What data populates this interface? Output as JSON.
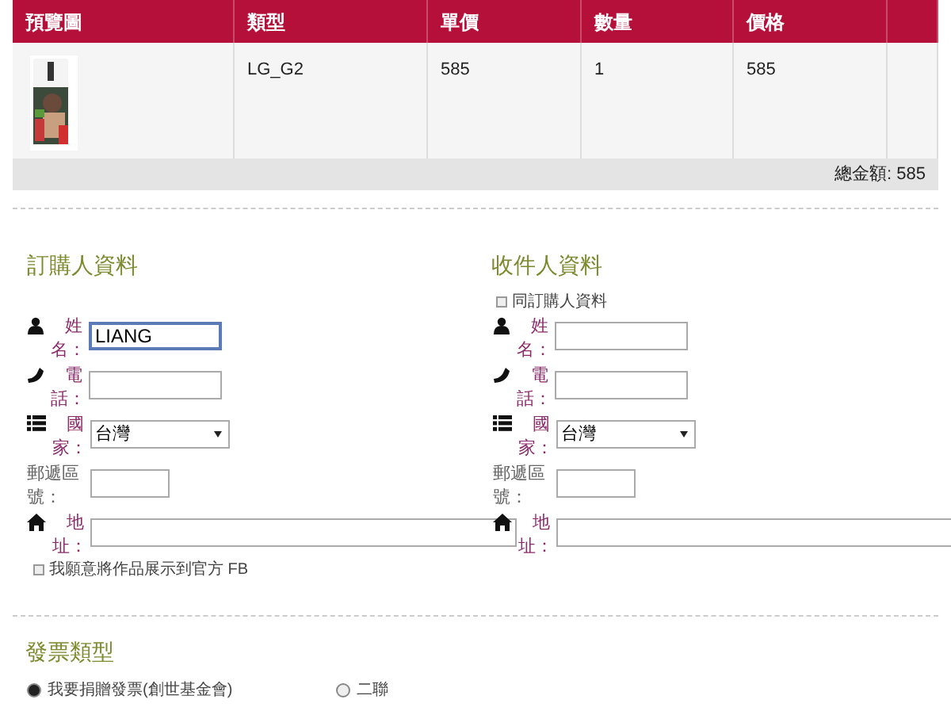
{
  "cart": {
    "columns": [
      "預覽圖",
      "類型",
      "單價",
      "數量",
      "價格",
      ""
    ],
    "rows": [
      {
        "type": "LG_G2",
        "unit_price": "585",
        "quantity": "1",
        "price": "585"
      }
    ],
    "total": "總金額: 585"
  },
  "buyer": {
    "title": "訂購人資料",
    "fields": [
      {
        "kind": "text",
        "label": "姓名：",
        "value": "LIANG",
        "focused": true
      },
      {
        "kind": "text",
        "label": "電話：",
        "focused": false
      },
      {
        "kind": "select",
        "label": "國家：",
        "value": "台灣",
        "focused": false
      },
      {
        "kind": "zip",
        "label": "郵遞區號：",
        "focused": false
      },
      {
        "kind": "address",
        "label": "地址：",
        "focused": false
      }
    ],
    "consent": {
      "label": "我願意將作品展示到官方 FB",
      "checked": false
    }
  },
  "recipient": {
    "title": "收件人資料",
    "same_as_buyer": {
      "label": "同訂購人資料",
      "checked": false
    },
    "fields": [
      {
        "kind": "text",
        "label": "姓名：",
        "focused": false
      },
      {
        "kind": "text",
        "label": "電話：",
        "focused": false
      },
      {
        "kind": "select",
        "label": "國家：",
        "value": "台灣",
        "focused": false
      },
      {
        "kind": "zip",
        "label": "郵遞區號：",
        "focused": false
      },
      {
        "kind": "address",
        "label": "地址：",
        "focused": false
      }
    ]
  },
  "invoice": {
    "title": "發票類型",
    "options": [
      {
        "label": "我要捐贈發票(創世基金會)",
        "selected": true
      },
      {
        "label": "二聯",
        "selected": false
      }
    ]
  }
}
